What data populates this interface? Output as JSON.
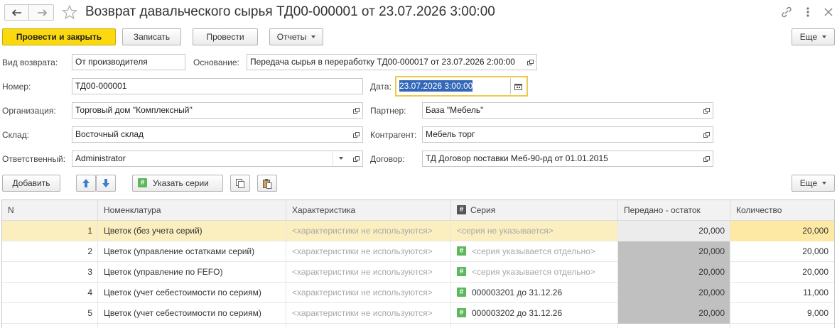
{
  "window": {
    "title": "Возврат давальческого сырья ТД00-000001 от 23.07.2026 3:00:00"
  },
  "toolbar": {
    "post_close": "Провести и закрыть",
    "save": "Записать",
    "post": "Провести",
    "reports": "Отчеты",
    "more": "Еще"
  },
  "form": {
    "return_type_label": "Вид возврата:",
    "return_type_value": "От производителя",
    "basis_label": "Основание:",
    "basis_value": "Передача сырья в переработку ТД00-000017 от 23.07.2026 2:00:00",
    "number_label": "Номер:",
    "number_value": "ТД00-000001",
    "date_label": "Дата:",
    "date_value": "23.07.2026  3:00:00",
    "org_label": "Организация:",
    "org_value": "Торговый дом \"Комплексный\"",
    "partner_label": "Партнер:",
    "partner_value": "База \"Мебель\"",
    "warehouse_label": "Склад:",
    "warehouse_value": "Восточный склад",
    "counterparty_label": "Контрагент:",
    "counterparty_value": "Мебель торг",
    "responsible_label": "Ответственный:",
    "responsible_value": "Administrator",
    "contract_label": "Договор:",
    "contract_value": "ТД Договор поставки Меб-90-рд от 01.01.2015"
  },
  "table_toolbar": {
    "add": "Добавить",
    "specify_series": "Указать серии",
    "more": "Еще"
  },
  "table": {
    "columns": {
      "n": "N",
      "item": "Номенклатура",
      "characteristic": "Характеристика",
      "series": "Серия",
      "transferred": "Передано - остаток",
      "quantity": "Количество"
    },
    "rows": [
      {
        "n": "1",
        "item": "Цветок (без учета серий)",
        "characteristic": "<характеристики не используются>",
        "series": "<серия не указывается>",
        "transferred": "20,000",
        "quantity": "20,000"
      },
      {
        "n": "2",
        "item": "Цветок (управление остатками серий)",
        "characteristic": "<характеристики не используются>",
        "series": "<серия указывается отдельно>",
        "transferred": "20,000",
        "quantity": "20,000"
      },
      {
        "n": "3",
        "item": "Цветок (управление по FEFO)",
        "characteristic": "<характеристики не используются>",
        "series": "<серия указывается отдельно>",
        "transferred": "20,000",
        "quantity": "20,000"
      },
      {
        "n": "4",
        "item": "Цветок (учет себестоимости по сериям)",
        "characteristic": "<характеристики не используются>",
        "series": "000003201 до 31.12.26",
        "transferred": "20,000",
        "quantity": "11,000"
      },
      {
        "n": "5",
        "item": "Цветок (учет себестоимости по сериям)",
        "characteristic": "<характеристики не используются>",
        "series": "000003202 до 31.12.26",
        "transferred": "20,000",
        "quantity": "9,000"
      }
    ]
  },
  "colors": {
    "accent_yellow": "#fbd90e",
    "selected_row": "#fbefbf",
    "gray_cell": "#c0c0c0",
    "focus_border": "#efc94c"
  }
}
